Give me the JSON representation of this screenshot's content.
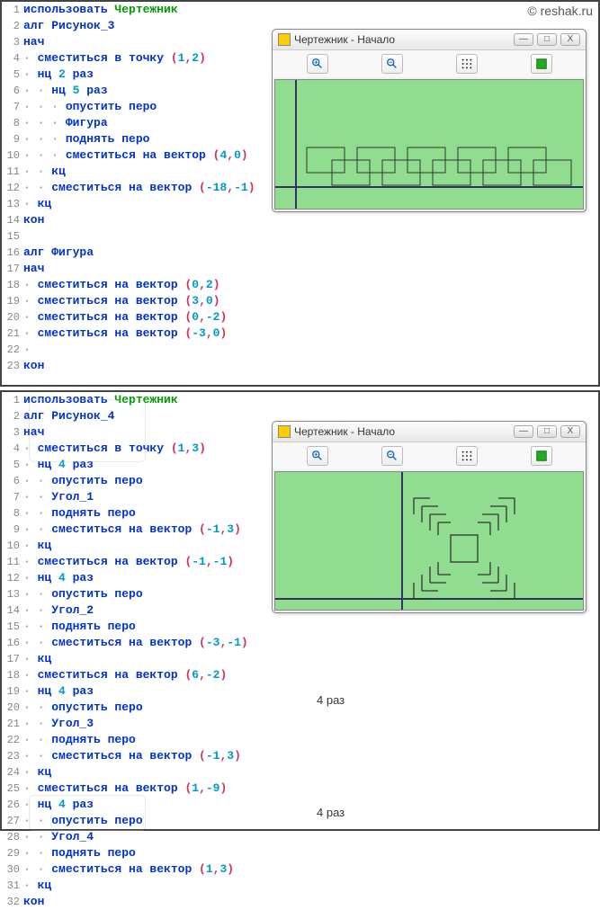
{
  "site": "© reshak.ru",
  "window_title": "Чертежник - Начало",
  "annotations": {
    "a1": "4 раз",
    "a2": "4 раз"
  },
  "panel1": {
    "lines": [
      {
        "n": "1",
        "segs": [
          {
            "t": "использовать ",
            "c": "kw"
          },
          {
            "t": "Чертежник",
            "c": "mod"
          }
        ]
      },
      {
        "n": "2",
        "segs": [
          {
            "t": "алг ",
            "c": "kw"
          },
          {
            "t": "Рисунок_3",
            "c": "kw"
          }
        ]
      },
      {
        "n": "3",
        "segs": [
          {
            "t": "нач",
            "c": "kw"
          }
        ]
      },
      {
        "n": "4",
        "segs": [
          {
            "t": "· ",
            "c": "dot"
          },
          {
            "t": "сместиться в точку ",
            "c": "kw"
          },
          {
            "t": "(",
            "c": "punct"
          },
          {
            "t": "1",
            "c": "num"
          },
          {
            "t": ",",
            "c": "punct"
          },
          {
            "t": "2",
            "c": "num"
          },
          {
            "t": ")",
            "c": "punct"
          }
        ]
      },
      {
        "n": "5",
        "segs": [
          {
            "t": "· ",
            "c": "dot"
          },
          {
            "t": "нц ",
            "c": "kw"
          },
          {
            "t": "2",
            "c": "num"
          },
          {
            "t": " раз",
            "c": "kw"
          }
        ]
      },
      {
        "n": "6",
        "segs": [
          {
            "t": "· · ",
            "c": "dot"
          },
          {
            "t": "нц ",
            "c": "kw"
          },
          {
            "t": "5",
            "c": "num"
          },
          {
            "t": " раз",
            "c": "kw"
          }
        ]
      },
      {
        "n": "7",
        "segs": [
          {
            "t": "· · · ",
            "c": "dot"
          },
          {
            "t": "опустить перо",
            "c": "kw"
          }
        ]
      },
      {
        "n": "8",
        "segs": [
          {
            "t": "· · · ",
            "c": "dot"
          },
          {
            "t": "Фигура",
            "c": "kw"
          }
        ]
      },
      {
        "n": "9",
        "segs": [
          {
            "t": "· · · ",
            "c": "dot"
          },
          {
            "t": "поднять перо",
            "c": "kw"
          }
        ]
      },
      {
        "n": "10",
        "segs": [
          {
            "t": "· · · ",
            "c": "dot"
          },
          {
            "t": "сместиться на вектор ",
            "c": "kw"
          },
          {
            "t": "(",
            "c": "punct"
          },
          {
            "t": "4",
            "c": "num"
          },
          {
            "t": ",",
            "c": "punct"
          },
          {
            "t": "0",
            "c": "num"
          },
          {
            "t": ")",
            "c": "punct"
          }
        ]
      },
      {
        "n": "11",
        "segs": [
          {
            "t": "· · ",
            "c": "dot"
          },
          {
            "t": "кц",
            "c": "kw"
          }
        ]
      },
      {
        "n": "12",
        "segs": [
          {
            "t": "· · ",
            "c": "dot"
          },
          {
            "t": "сместиться на вектор ",
            "c": "kw"
          },
          {
            "t": "(",
            "c": "punct"
          },
          {
            "t": "-18",
            "c": "num"
          },
          {
            "t": ",",
            "c": "punct"
          },
          {
            "t": "-1",
            "c": "num"
          },
          {
            "t": ")",
            "c": "punct"
          }
        ]
      },
      {
        "n": "13",
        "segs": [
          {
            "t": "· ",
            "c": "dot"
          },
          {
            "t": "кц",
            "c": "kw"
          }
        ]
      },
      {
        "n": "14",
        "segs": [
          {
            "t": "кон",
            "c": "kw"
          }
        ]
      },
      {
        "n": "15",
        "segs": []
      },
      {
        "n": "16",
        "segs": [
          {
            "t": "алг ",
            "c": "kw"
          },
          {
            "t": "Фигура",
            "c": "kw"
          }
        ]
      },
      {
        "n": "17",
        "segs": [
          {
            "t": "нач",
            "c": "kw"
          }
        ]
      },
      {
        "n": "18",
        "segs": [
          {
            "t": "· ",
            "c": "dot"
          },
          {
            "t": "сместиться на вектор ",
            "c": "kw"
          },
          {
            "t": "(",
            "c": "punct"
          },
          {
            "t": "0",
            "c": "num"
          },
          {
            "t": ",",
            "c": "punct"
          },
          {
            "t": "2",
            "c": "num"
          },
          {
            "t": ")",
            "c": "punct"
          }
        ]
      },
      {
        "n": "19",
        "segs": [
          {
            "t": "· ",
            "c": "dot"
          },
          {
            "t": "сместиться на вектор ",
            "c": "kw"
          },
          {
            "t": "(",
            "c": "punct"
          },
          {
            "t": "3",
            "c": "num"
          },
          {
            "t": ",",
            "c": "punct"
          },
          {
            "t": "0",
            "c": "num"
          },
          {
            "t": ")",
            "c": "punct"
          }
        ]
      },
      {
        "n": "20",
        "segs": [
          {
            "t": "· ",
            "c": "dot"
          },
          {
            "t": "сместиться на вектор ",
            "c": "kw"
          },
          {
            "t": "(",
            "c": "punct"
          },
          {
            "t": "0",
            "c": "num"
          },
          {
            "t": ",",
            "c": "punct"
          },
          {
            "t": "-2",
            "c": "num"
          },
          {
            "t": ")",
            "c": "punct"
          }
        ]
      },
      {
        "n": "21",
        "segs": [
          {
            "t": "· ",
            "c": "dot"
          },
          {
            "t": "сместиться на вектор ",
            "c": "kw"
          },
          {
            "t": "(",
            "c": "punct"
          },
          {
            "t": "-3",
            "c": "num"
          },
          {
            "t": ",",
            "c": "punct"
          },
          {
            "t": "0",
            "c": "num"
          },
          {
            "t": ")",
            "c": "punct"
          }
        ]
      },
      {
        "n": "22",
        "segs": [
          {
            "t": "·",
            "c": "dot"
          }
        ]
      },
      {
        "n": "23",
        "segs": [
          {
            "t": "кон",
            "c": "kw"
          }
        ]
      }
    ]
  },
  "panel2": {
    "lines": [
      {
        "n": "1",
        "segs": [
          {
            "t": "использовать ",
            "c": "kw"
          },
          {
            "t": "Чертежник",
            "c": "mod"
          }
        ]
      },
      {
        "n": "2",
        "segs": [
          {
            "t": "алг ",
            "c": "kw"
          },
          {
            "t": "Рисунок_4",
            "c": "kw"
          }
        ]
      },
      {
        "n": "3",
        "segs": [
          {
            "t": "нач",
            "c": "kw"
          }
        ]
      },
      {
        "n": "4",
        "segs": [
          {
            "t": "· ",
            "c": "dot"
          },
          {
            "t": "сместиться в точку ",
            "c": "kw"
          },
          {
            "t": "(",
            "c": "punct"
          },
          {
            "t": "1",
            "c": "num"
          },
          {
            "t": ",",
            "c": "punct"
          },
          {
            "t": "3",
            "c": "num"
          },
          {
            "t": ")",
            "c": "punct"
          }
        ]
      },
      {
        "n": "5",
        "segs": [
          {
            "t": "· ",
            "c": "dot"
          },
          {
            "t": "нц ",
            "c": "kw"
          },
          {
            "t": "4",
            "c": "num"
          },
          {
            "t": " раз",
            "c": "kw"
          }
        ]
      },
      {
        "n": "6",
        "segs": [
          {
            "t": "· · ",
            "c": "dot"
          },
          {
            "t": "опустить перо",
            "c": "kw"
          }
        ]
      },
      {
        "n": "7",
        "segs": [
          {
            "t": "· · ",
            "c": "dot"
          },
          {
            "t": "Угол_1",
            "c": "kw"
          }
        ]
      },
      {
        "n": "8",
        "segs": [
          {
            "t": "· · ",
            "c": "dot"
          },
          {
            "t": "поднять перо",
            "c": "kw"
          }
        ]
      },
      {
        "n": "9",
        "segs": [
          {
            "t": "· · ",
            "c": "dot"
          },
          {
            "t": "сместиться на вектор ",
            "c": "kw"
          },
          {
            "t": "(",
            "c": "punct"
          },
          {
            "t": "-1",
            "c": "num"
          },
          {
            "t": ",",
            "c": "punct"
          },
          {
            "t": "3",
            "c": "num"
          },
          {
            "t": ")",
            "c": "punct"
          }
        ]
      },
      {
        "n": "10",
        "segs": [
          {
            "t": "· ",
            "c": "dot"
          },
          {
            "t": "кц",
            "c": "kw"
          }
        ]
      },
      {
        "n": "11",
        "segs": [
          {
            "t": "· ",
            "c": "dot"
          },
          {
            "t": "сместиться на вектор ",
            "c": "kw"
          },
          {
            "t": "(",
            "c": "punct"
          },
          {
            "t": "-1",
            "c": "num"
          },
          {
            "t": ",",
            "c": "punct"
          },
          {
            "t": "-1",
            "c": "num"
          },
          {
            "t": ")",
            "c": "punct"
          }
        ]
      },
      {
        "n": "12",
        "segs": [
          {
            "t": "· ",
            "c": "dot"
          },
          {
            "t": "нц ",
            "c": "kw"
          },
          {
            "t": "4",
            "c": "num"
          },
          {
            "t": " раз",
            "c": "kw"
          }
        ]
      },
      {
        "n": "13",
        "segs": [
          {
            "t": "· · ",
            "c": "dot"
          },
          {
            "t": "опустить перо",
            "c": "kw"
          }
        ]
      },
      {
        "n": "14",
        "segs": [
          {
            "t": "· · ",
            "c": "dot"
          },
          {
            "t": "Угол_2",
            "c": "kw"
          }
        ]
      },
      {
        "n": "15",
        "segs": [
          {
            "t": "· · ",
            "c": "dot"
          },
          {
            "t": "поднять перо",
            "c": "kw"
          }
        ]
      },
      {
        "n": "16",
        "segs": [
          {
            "t": "· · ",
            "c": "dot"
          },
          {
            "t": "сместиться на вектор ",
            "c": "kw"
          },
          {
            "t": "(",
            "c": "punct"
          },
          {
            "t": "-3",
            "c": "num"
          },
          {
            "t": ",",
            "c": "punct"
          },
          {
            "t": "-1",
            "c": "num"
          },
          {
            "t": ")",
            "c": "punct"
          }
        ]
      },
      {
        "n": "17",
        "segs": [
          {
            "t": "· ",
            "c": "dot"
          },
          {
            "t": "кц",
            "c": "kw"
          }
        ]
      },
      {
        "n": "18",
        "segs": [
          {
            "t": "· ",
            "c": "dot"
          },
          {
            "t": "сместиться на вектор ",
            "c": "kw"
          },
          {
            "t": "(",
            "c": "punct"
          },
          {
            "t": "6",
            "c": "num"
          },
          {
            "t": ",",
            "c": "punct"
          },
          {
            "t": "-2",
            "c": "num"
          },
          {
            "t": ")",
            "c": "punct"
          }
        ]
      },
      {
        "n": "19",
        "segs": [
          {
            "t": "· ",
            "c": "dot"
          },
          {
            "t": "нц ",
            "c": "kw"
          },
          {
            "t": "4",
            "c": "num"
          },
          {
            "t": " раз",
            "c": "kw"
          }
        ]
      },
      {
        "n": "20",
        "segs": [
          {
            "t": "· · ",
            "c": "dot"
          },
          {
            "t": "опустить перо",
            "c": "kw"
          }
        ]
      },
      {
        "n": "21",
        "segs": [
          {
            "t": "· · ",
            "c": "dot"
          },
          {
            "t": "Угол_3",
            "c": "kw"
          }
        ]
      },
      {
        "n": "22",
        "segs": [
          {
            "t": "· · ",
            "c": "dot"
          },
          {
            "t": "поднять перо",
            "c": "kw"
          }
        ]
      },
      {
        "n": "23",
        "segs": [
          {
            "t": "· · ",
            "c": "dot"
          },
          {
            "t": "сместиться на вектор ",
            "c": "kw"
          },
          {
            "t": "(",
            "c": "punct"
          },
          {
            "t": "-1",
            "c": "num"
          },
          {
            "t": ",",
            "c": "punct"
          },
          {
            "t": "3",
            "c": "num"
          },
          {
            "t": ")",
            "c": "punct"
          }
        ]
      },
      {
        "n": "24",
        "segs": [
          {
            "t": "· ",
            "c": "dot"
          },
          {
            "t": "кц",
            "c": "kw"
          }
        ]
      },
      {
        "n": "25",
        "segs": [
          {
            "t": "· ",
            "c": "dot"
          },
          {
            "t": "сместиться на вектор ",
            "c": "kw"
          },
          {
            "t": "(",
            "c": "punct"
          },
          {
            "t": "1",
            "c": "num"
          },
          {
            "t": ",",
            "c": "punct"
          },
          {
            "t": "-9",
            "c": "num"
          },
          {
            "t": ")",
            "c": "punct"
          }
        ]
      },
      {
        "n": "26",
        "segs": [
          {
            "t": "· ",
            "c": "dot"
          },
          {
            "t": "нц ",
            "c": "kw"
          },
          {
            "t": "4",
            "c": "num"
          },
          {
            "t": " раз",
            "c": "kw"
          }
        ]
      },
      {
        "n": "27",
        "segs": [
          {
            "t": "· · ",
            "c": "dot"
          },
          {
            "t": "опустить перо",
            "c": "kw"
          }
        ]
      },
      {
        "n": "28",
        "segs": [
          {
            "t": "· · ",
            "c": "dot"
          },
          {
            "t": "Угол_4",
            "c": "kw"
          }
        ]
      },
      {
        "n": "29",
        "segs": [
          {
            "t": "· · ",
            "c": "dot"
          },
          {
            "t": "поднять перо",
            "c": "kw"
          }
        ]
      },
      {
        "n": "30",
        "segs": [
          {
            "t": "· · ",
            "c": "dot"
          },
          {
            "t": "сместиться на вектор ",
            "c": "kw"
          },
          {
            "t": "(",
            "c": "punct"
          },
          {
            "t": "1",
            "c": "num"
          },
          {
            "t": ",",
            "c": "punct"
          },
          {
            "t": "3",
            "c": "num"
          },
          {
            "t": ")",
            "c": "punct"
          }
        ]
      },
      {
        "n": "31",
        "segs": [
          {
            "t": "· ",
            "c": "dot"
          },
          {
            "t": "кц",
            "c": "kw"
          }
        ]
      },
      {
        "n": "32",
        "segs": [
          {
            "t": "кон",
            "c": "kw"
          }
        ]
      }
    ]
  }
}
